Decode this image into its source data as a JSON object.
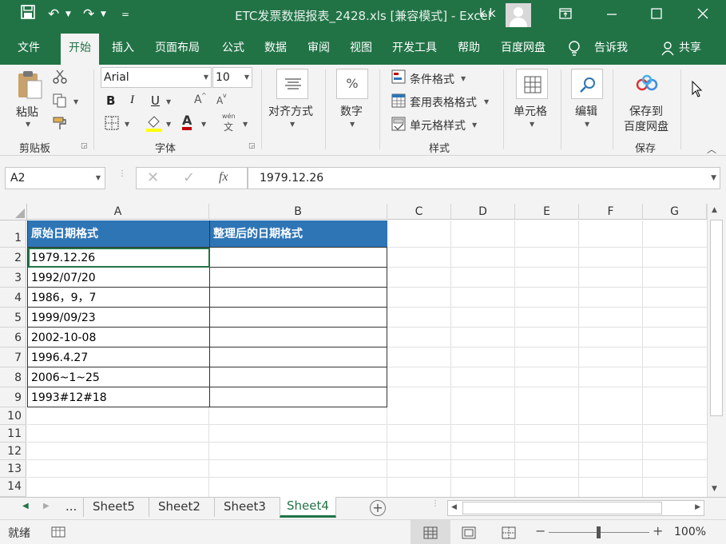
{
  "titlebar": {
    "title": "ETC发票数据报表_2428.xls  [兼容模式]  -  Excel",
    "user": "k k",
    "qa_more": "="
  },
  "menu": {
    "tabs": [
      "文件",
      "开始",
      "插入",
      "页面布局",
      "公式",
      "数据",
      "审阅",
      "视图",
      "开发工具",
      "帮助",
      "百度网盘"
    ],
    "active": "开始",
    "tell_me": "告诉我",
    "share": "共享"
  },
  "ribbon": {
    "clipboard": {
      "paste": "粘贴",
      "label": "剪贴板"
    },
    "font": {
      "name": "Arial",
      "size": "10",
      "label": "字体",
      "bold": "B",
      "italic": "I",
      "underline": "U",
      "grow": "A",
      "shrink": "A",
      "font_color": "A",
      "wen": "wén",
      "wen_char": "文"
    },
    "alignment": {
      "label": "对齐方式"
    },
    "number": {
      "label": "数字",
      "symbol": "%"
    },
    "styles": {
      "conditional": "条件格式",
      "table": "套用表格格式",
      "cell": "单元格样式",
      "label": "样式"
    },
    "cells": {
      "label": "单元格"
    },
    "editing": {
      "label": "编辑"
    },
    "save": {
      "line1": "保存到",
      "line2": "百度网盘",
      "label": "保存"
    }
  },
  "formula_bar": {
    "name_box": "A2",
    "formula": "1979.12.26",
    "fx": "fx"
  },
  "sheet": {
    "columns": [
      "A",
      "B",
      "C",
      "D",
      "E",
      "F",
      "G"
    ],
    "rows": [
      "1",
      "2",
      "3",
      "4",
      "5",
      "6",
      "7",
      "8",
      "9",
      "10",
      "11",
      "12",
      "13",
      "14"
    ],
    "header": [
      "原始日期格式",
      "整理后的日期格式"
    ],
    "values": [
      "1979.12.26",
      "1992/07/20",
      "1986，9，7",
      "1999/09/23",
      "2002-10-08",
      "1996.4.27",
      "2006~1~25",
      "1993#12#18"
    ]
  },
  "tabs": {
    "ellipsis": "...",
    "sheets": [
      "Sheet5",
      "Sheet2",
      "Sheet3",
      "Sheet4"
    ],
    "active": "Sheet4",
    "add": "+"
  },
  "status": {
    "ready": "就绪",
    "zoom": "100%",
    "minus": "−",
    "plus": "+"
  },
  "colors": {
    "brand": "#217346",
    "header_fill": "#2e75b6"
  }
}
